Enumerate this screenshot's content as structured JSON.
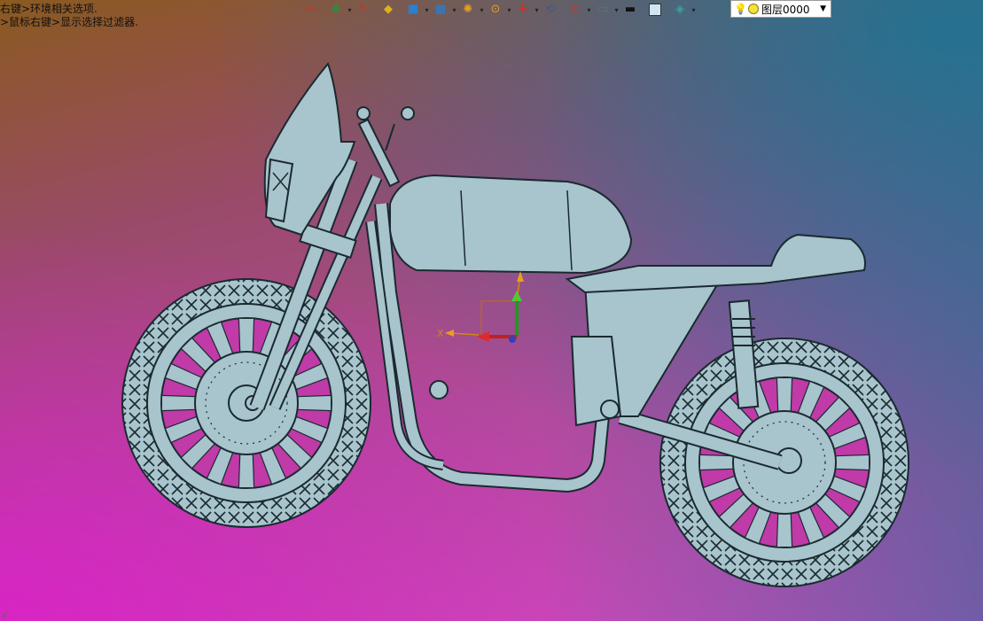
{
  "hints": {
    "line1": "右键>环境相关选项.",
    "line2": ">鼠标右键>显示选择过滤器."
  },
  "toolbar": {
    "items": [
      {
        "name": "view-icon",
        "color": "#c0392b"
      },
      {
        "name": "assembly-icon",
        "color": "#2e8b3a",
        "dropdown": true
      },
      {
        "name": "pen-icon",
        "color": "#c0392b"
      },
      {
        "name": "box-shade-icon",
        "color": "#e0b01a"
      },
      {
        "name": "cube-icon",
        "color": "#2a7fd0",
        "dropdown": true
      },
      {
        "name": "multi-cube-icon",
        "color": "#2a7fd0",
        "dropdown": true
      },
      {
        "name": "section-icon",
        "color": "#e8a020",
        "dropdown": true
      },
      {
        "name": "zoom-icon",
        "color": "#e8a020",
        "dropdown": true
      },
      {
        "name": "snap-icon",
        "color": "#c0392b",
        "dropdown": true
      },
      {
        "name": "orient-icon",
        "color": "#3a5a8a"
      },
      {
        "name": "dimension-icon",
        "color": "#c0392b",
        "dropdown": true
      },
      {
        "name": "monitor-icon",
        "color": "#607080",
        "dropdown": true
      },
      {
        "name": "line-color-icon",
        "color": "#111111"
      },
      {
        "name": "face-color-icon",
        "color": "#cfe6f2"
      },
      {
        "name": "layer-plane-icon",
        "color": "#3aa0a0",
        "dropdown": true
      }
    ]
  },
  "layer": {
    "value": "图层0000"
  },
  "triad": {
    "x_label": "X"
  },
  "colors": {
    "model_fill": "#a8c4cc",
    "model_stroke": "#1a2a30",
    "rim_cutout": "#c03aa8"
  }
}
